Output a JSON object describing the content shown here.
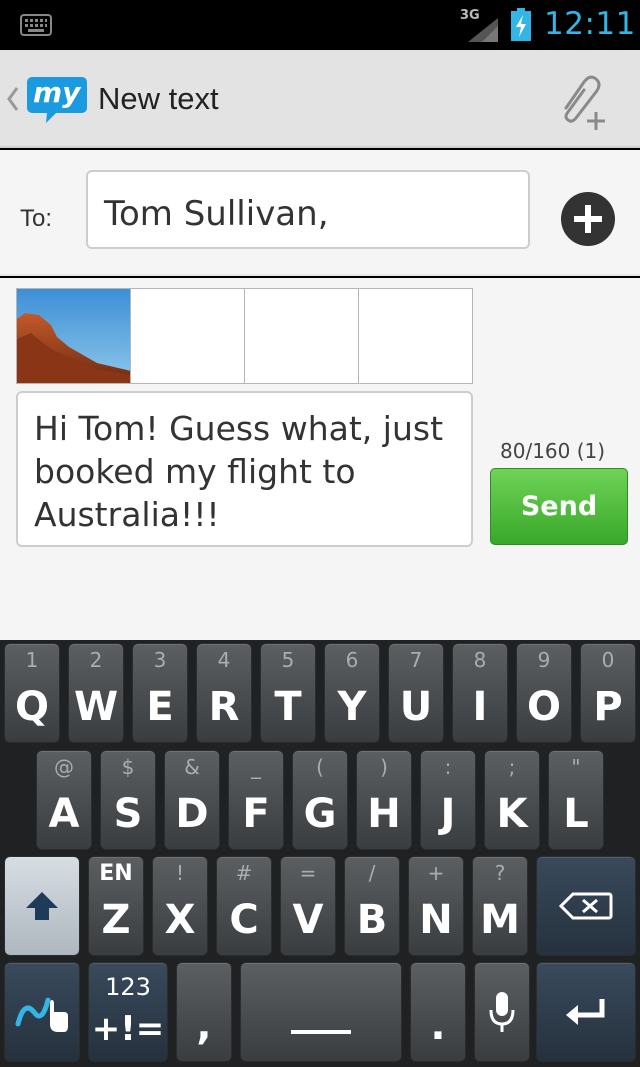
{
  "status_bar": {
    "network_label": "3G",
    "time": "12:11",
    "clock_color": "#33b5e5"
  },
  "action_bar": {
    "logo_text": "my",
    "title": "New text",
    "icons": [
      "back-chevron-icon",
      "app-logo",
      "paperclip-add-icon"
    ]
  },
  "recipient": {
    "label": "To:",
    "value": "Tom Sullivan,"
  },
  "compose": {
    "message": "Hi Tom! Guess what, just booked my flight to Australia!!!",
    "counter": "80/160 (1)",
    "send_label": "Send",
    "send_color": "#4cbf3a"
  },
  "keyboard": {
    "row1": [
      {
        "main": "Q",
        "sub": "1"
      },
      {
        "main": "W",
        "sub": "2"
      },
      {
        "main": "E",
        "sub": "3"
      },
      {
        "main": "R",
        "sub": "4"
      },
      {
        "main": "T",
        "sub": "5"
      },
      {
        "main": "Y",
        "sub": "6"
      },
      {
        "main": "U",
        "sub": "7"
      },
      {
        "main": "I",
        "sub": "8"
      },
      {
        "main": "O",
        "sub": "9"
      },
      {
        "main": "P",
        "sub": "0"
      }
    ],
    "row2": [
      {
        "main": "A",
        "sub": "@"
      },
      {
        "main": "S",
        "sub": "$"
      },
      {
        "main": "D",
        "sub": "&"
      },
      {
        "main": "F",
        "sub": "_"
      },
      {
        "main": "G",
        "sub": "("
      },
      {
        "main": "H",
        "sub": ")"
      },
      {
        "main": "J",
        "sub": ":"
      },
      {
        "main": "K",
        "sub": ";"
      },
      {
        "main": "L",
        "sub": "\""
      }
    ],
    "row3": [
      {
        "main": "Z",
        "sub": "EN"
      },
      {
        "main": "X",
        "sub": "!"
      },
      {
        "main": "C",
        "sub": "#"
      },
      {
        "main": "V",
        "sub": "="
      },
      {
        "main": "B",
        "sub": "/"
      },
      {
        "main": "N",
        "sub": "+"
      },
      {
        "main": "M",
        "sub": "?"
      }
    ],
    "symbols_sub": "123",
    "symbols_main": "+!=",
    "comma": ",",
    "period": "."
  }
}
